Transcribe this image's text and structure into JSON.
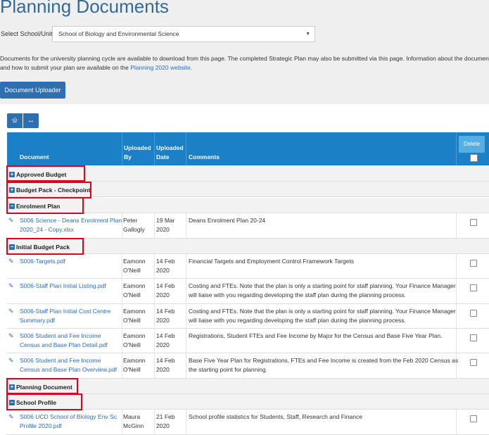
{
  "page": {
    "title": "Planning Documents",
    "select_label": "Select School/Unit:",
    "select_value": "School of Biology and Environmental Science",
    "description_line1": "Documents for the university planning cycle are available to download from this page. The completed Strategic Plan may also be submitted via this page. Information about the documen",
    "description_line2_prefix": "and how to submit your plan are available on the ",
    "description_link": "Planning 2020 website",
    "description_suffix": ".",
    "uploader_button": "Document Uploader"
  },
  "toolbar": {
    "pin_icon": "pin-icon",
    "expand_icon": "expand-width-icon"
  },
  "table": {
    "headers": {
      "document": "Document",
      "uploaded_by_1": "Uploaded",
      "uploaded_by_2": "By",
      "uploaded_date_1": "Uploaded",
      "uploaded_date_2": "Date",
      "comments": "Comments",
      "delete": "Delete"
    },
    "groups": {
      "approved_budget": "Approved Budget",
      "budget_pack": "Budget Pack - Checkpoint",
      "enrolment_plan": "Enrolment Plan",
      "initial_budget": "Initial Budget Pack",
      "planning_document": "Planning Document",
      "school_profile": "School Profile"
    },
    "rows": [
      {
        "doc1": "S006 Science - Deans Enrolment Plan",
        "doc2": "2020_24 - Copy.xlsx",
        "by1": "Peter",
        "by2": "Gallogly",
        "d1": "19 Mar",
        "d2": "2020",
        "cm1": "Deans Enrolment Plan 20-24",
        "cm2": ""
      },
      {
        "doc1": "S006-Targets.pdf",
        "doc2": "",
        "by1": "Eamonn",
        "by2": "O'Neill",
        "d1": "14 Feb",
        "d2": "2020",
        "cm1": "Financial Targets and Employment Control Framework Targets",
        "cm2": ""
      },
      {
        "doc1": "S006-Staff Plan Initial Listing.pdf",
        "doc2": "",
        "by1": "Eamonn",
        "by2": "O'Neill",
        "d1": "14 Feb",
        "d2": "2020",
        "cm1": "Costing and FTEs. Note that the plan is only a starting point for staff planning. Your Finance Manager",
        "cm2": "will liaise with you regarding developing the staff plan during the planning process."
      },
      {
        "doc1": "S006-Staff Plan Initial Cost Centre",
        "doc2": "Summary.pdf",
        "by1": "Eamonn",
        "by2": "O'Neill",
        "d1": "14 Feb",
        "d2": "2020",
        "cm1": "Costing and FTEs. Note that the plan is only a starting point for staff planning. Your Finance Manager",
        "cm2": "will liaise with you regarding developing the staff plan during the planning process."
      },
      {
        "doc1": "S006 Student and Fee Income",
        "doc2": "Census and Base Plan Detail.pdf",
        "by1": "Eamonn",
        "by2": "O'Neill",
        "d1": "14 Feb",
        "d2": "2020",
        "cm1": "Registrations, Student FTEs and Fee Income by Major for the Census and Base Five Year Plan.",
        "cm2": ""
      },
      {
        "doc1": "S006 Student and Fee Income",
        "doc2": "Census and Base Plan Overview.pdf",
        "by1": "Eamonn",
        "by2": "O'Neill",
        "d1": "14 Feb",
        "d2": "2020",
        "cm1": "Base Five Year Plan for Registrations, FTEs and Fee Income is created from the Feb 2020 Census as",
        "cm2": "the starting point for planning."
      },
      {
        "doc1": "S006 UCD School of Biology Env Sc",
        "doc2": "Profile 2020.pdf",
        "by1": "Maura",
        "by2": "McGinn",
        "d1": "21 Feb",
        "d2": "2020",
        "cm1": "School profile statistics for Students, Staff, Research and Finance",
        "cm2": ""
      }
    ]
  },
  "colors": {
    "accent": "#2f6fb0",
    "header": "#1b80c5",
    "highlight": "#e0001b"
  }
}
